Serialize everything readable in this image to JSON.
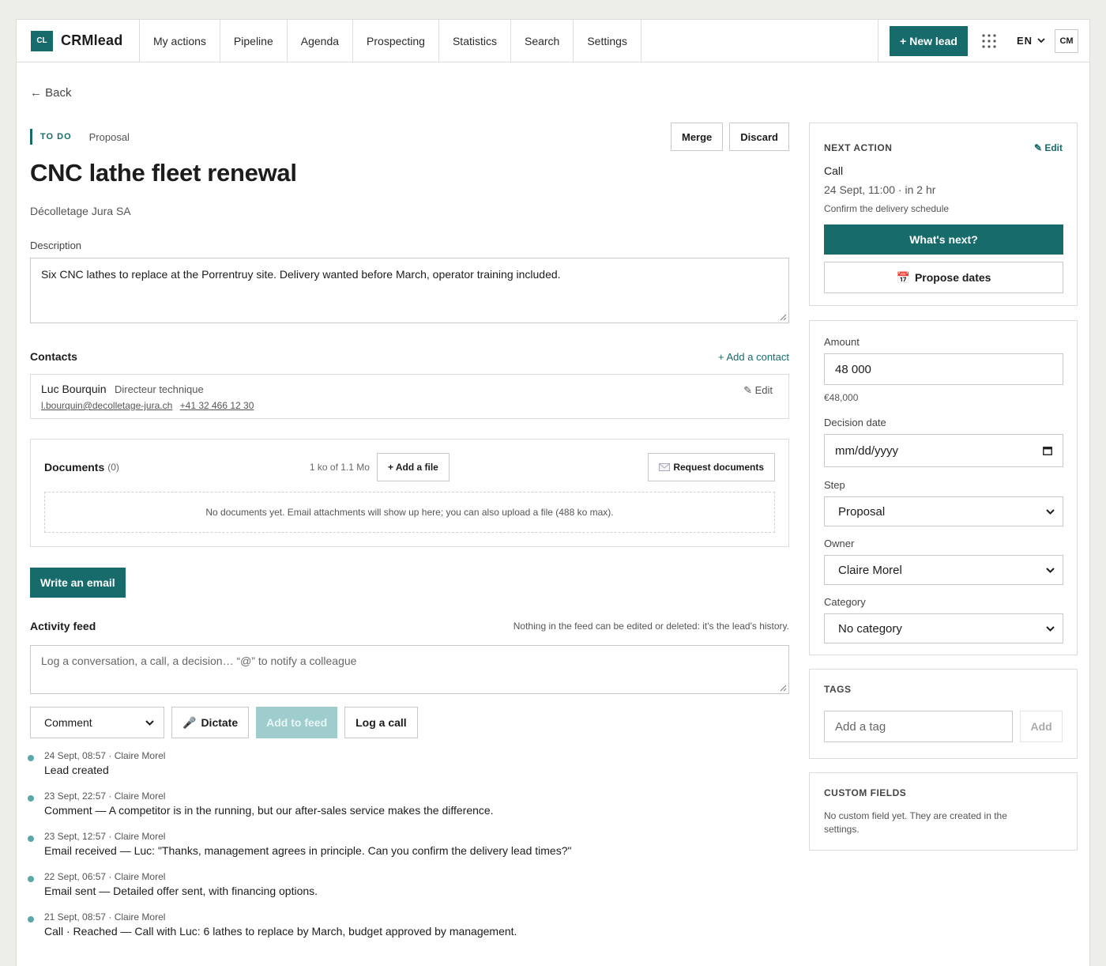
{
  "header": {
    "logo": "CL",
    "brand": "CRMlead",
    "nav": [
      "My actions",
      "Pipeline",
      "Agenda",
      "Prospecting",
      "Statistics",
      "Search",
      "Settings"
    ],
    "new_lead": "+ New lead",
    "lang": "EN",
    "user_initials": "CM"
  },
  "back": "← Back",
  "lead": {
    "status_badge": "TO DO",
    "stage": "Proposal",
    "merge": "Merge",
    "discard": "Discard",
    "title": "CNC lathe fleet renewal",
    "company": "Décolletage Jura SA",
    "description_label": "Description",
    "description": "Six CNC lathes to replace at the Porrentruy site. Delivery wanted before March, operator training included."
  },
  "contacts": {
    "title": "Contacts",
    "add": "+ Add a contact",
    "items": [
      {
        "name": "Luc Bourquin",
        "role": "Directeur technique",
        "email": "l.bourquin@decolletage-jura.ch",
        "phone": "+41 32 466 12 30",
        "edit": "✎ Edit"
      }
    ]
  },
  "documents": {
    "title": "Documents",
    "count": "(0)",
    "quota": "1 ko of 1.1 Mo",
    "add_file": "+ Add a file",
    "request": "Request documents",
    "empty": "No documents yet. Email attachments will show up here; you can also upload a file (488 ko max)."
  },
  "write_email": "Write an email",
  "feed": {
    "title": "Activity feed",
    "note": "Nothing in the feed can be edited or deleted: it's the lead's history.",
    "placeholder": "Log a conversation, a call, a decision… “@” to notify a colleague",
    "type_select": "Comment",
    "dictate": "Dictate",
    "add_to_feed": "Add to feed",
    "log_call": "Log a call",
    "entries": [
      {
        "meta": "24 Sept, 08:57 · Claire Morel",
        "text": "Lead created"
      },
      {
        "meta": "23 Sept, 22:57 · Claire Morel",
        "text": "Comment — A competitor is in the running, but our after-sales service makes the difference."
      },
      {
        "meta": "23 Sept, 12:57 · Claire Morel",
        "text": "Email received — Luc: \"Thanks, management agrees in principle. Can you confirm the delivery lead times?\""
      },
      {
        "meta": "22 Sept, 06:57 · Claire Morel",
        "text": "Email sent — Detailed offer sent, with financing options."
      },
      {
        "meta": "21 Sept, 08:57 · Claire Morel",
        "text": "Call · Reached — Call with Luc: 6 lathes to replace by March, budget approved by management."
      }
    ]
  },
  "next_action": {
    "caption": "NEXT ACTION",
    "edit": "✎ Edit",
    "type": "Call",
    "when": "24 Sept, 11:00 · in 2 hr",
    "note": "Confirm the delivery schedule",
    "whats_next": "What's next?",
    "propose_dates": "Propose dates"
  },
  "details": {
    "amount_label": "Amount",
    "amount": "48 000",
    "amount_formatted": "€48,000",
    "decision_label": "Decision date",
    "decision_placeholder": "mm/dd/yyyy",
    "step_label": "Step",
    "step": "Proposal",
    "owner_label": "Owner",
    "owner": "Claire Morel",
    "category_label": "Category",
    "category": "No category"
  },
  "tags": {
    "caption": "TAGS",
    "placeholder": "Add a tag",
    "add": "Add"
  },
  "custom_fields": {
    "caption": "CUSTOM FIELDS",
    "empty": "No custom field yet. They are created in the settings."
  },
  "colors": {
    "accent": "#176b6b",
    "accent_disabled": "#9fcccc",
    "timeline_dot": "#5aa8a8"
  }
}
